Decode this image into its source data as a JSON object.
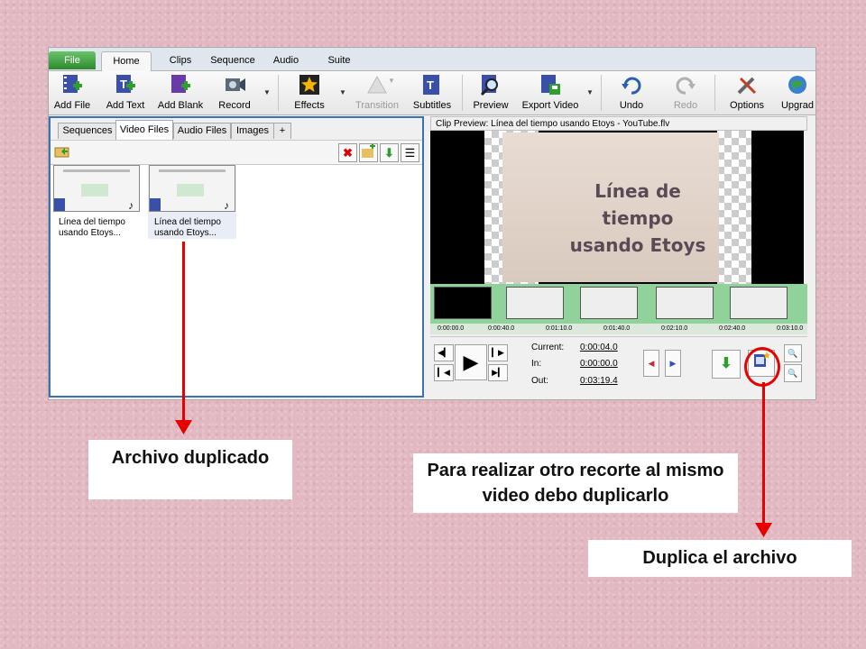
{
  "tabs": [
    "File",
    "Home",
    "Clips",
    "Sequence",
    "Audio",
    "Suite"
  ],
  "ribbon": {
    "add_file": "Add File",
    "add_text": "Add Text",
    "add_blank": "Add Blank",
    "record": "Record",
    "effects": "Effects",
    "transition": "Transition",
    "subtitles": "Subtitles",
    "preview": "Preview",
    "export_video": "Export Video",
    "undo": "Undo",
    "redo": "Redo",
    "options": "Options",
    "upgrade": "Upgrad"
  },
  "left_panel": {
    "tabs": [
      "Sequences",
      "Video Files",
      "Audio Files",
      "Images",
      "+"
    ],
    "files": [
      {
        "line1": "Línea del tiempo",
        "line2": "usando Etoys..."
      },
      {
        "line1": "Línea del tiempo",
        "line2": "usando Etoys..."
      }
    ]
  },
  "clip_preview": {
    "title": "Clip Preview: Línea del tiempo usando Etoys - YouTube.flv",
    "slide_text": [
      "Línea de",
      "tiempo",
      "usando Etoys"
    ],
    "ruler_labels": [
      "0:00:00.0",
      "0:00:40.0",
      "0:01:10.0",
      "0:01:40.0",
      "0:02:10.0",
      "0:02:40.0",
      "0:03:10.0"
    ],
    "current_label": "Current:",
    "current_value": "0:00:04.0",
    "in_label": "In:",
    "in_value": "0:00:00.0",
    "out_label": "Out:",
    "out_value": "0:03:19.4"
  },
  "annotations": {
    "archivo": "Archivo duplicado",
    "para": "Para realizar otro recorte al mismo video debo duplicarlo",
    "duplica": "Duplica el archivo"
  },
  "colors": {
    "accent": "#e60000",
    "panel_border": "#3b6fb6",
    "background": "#e2b9c2"
  }
}
